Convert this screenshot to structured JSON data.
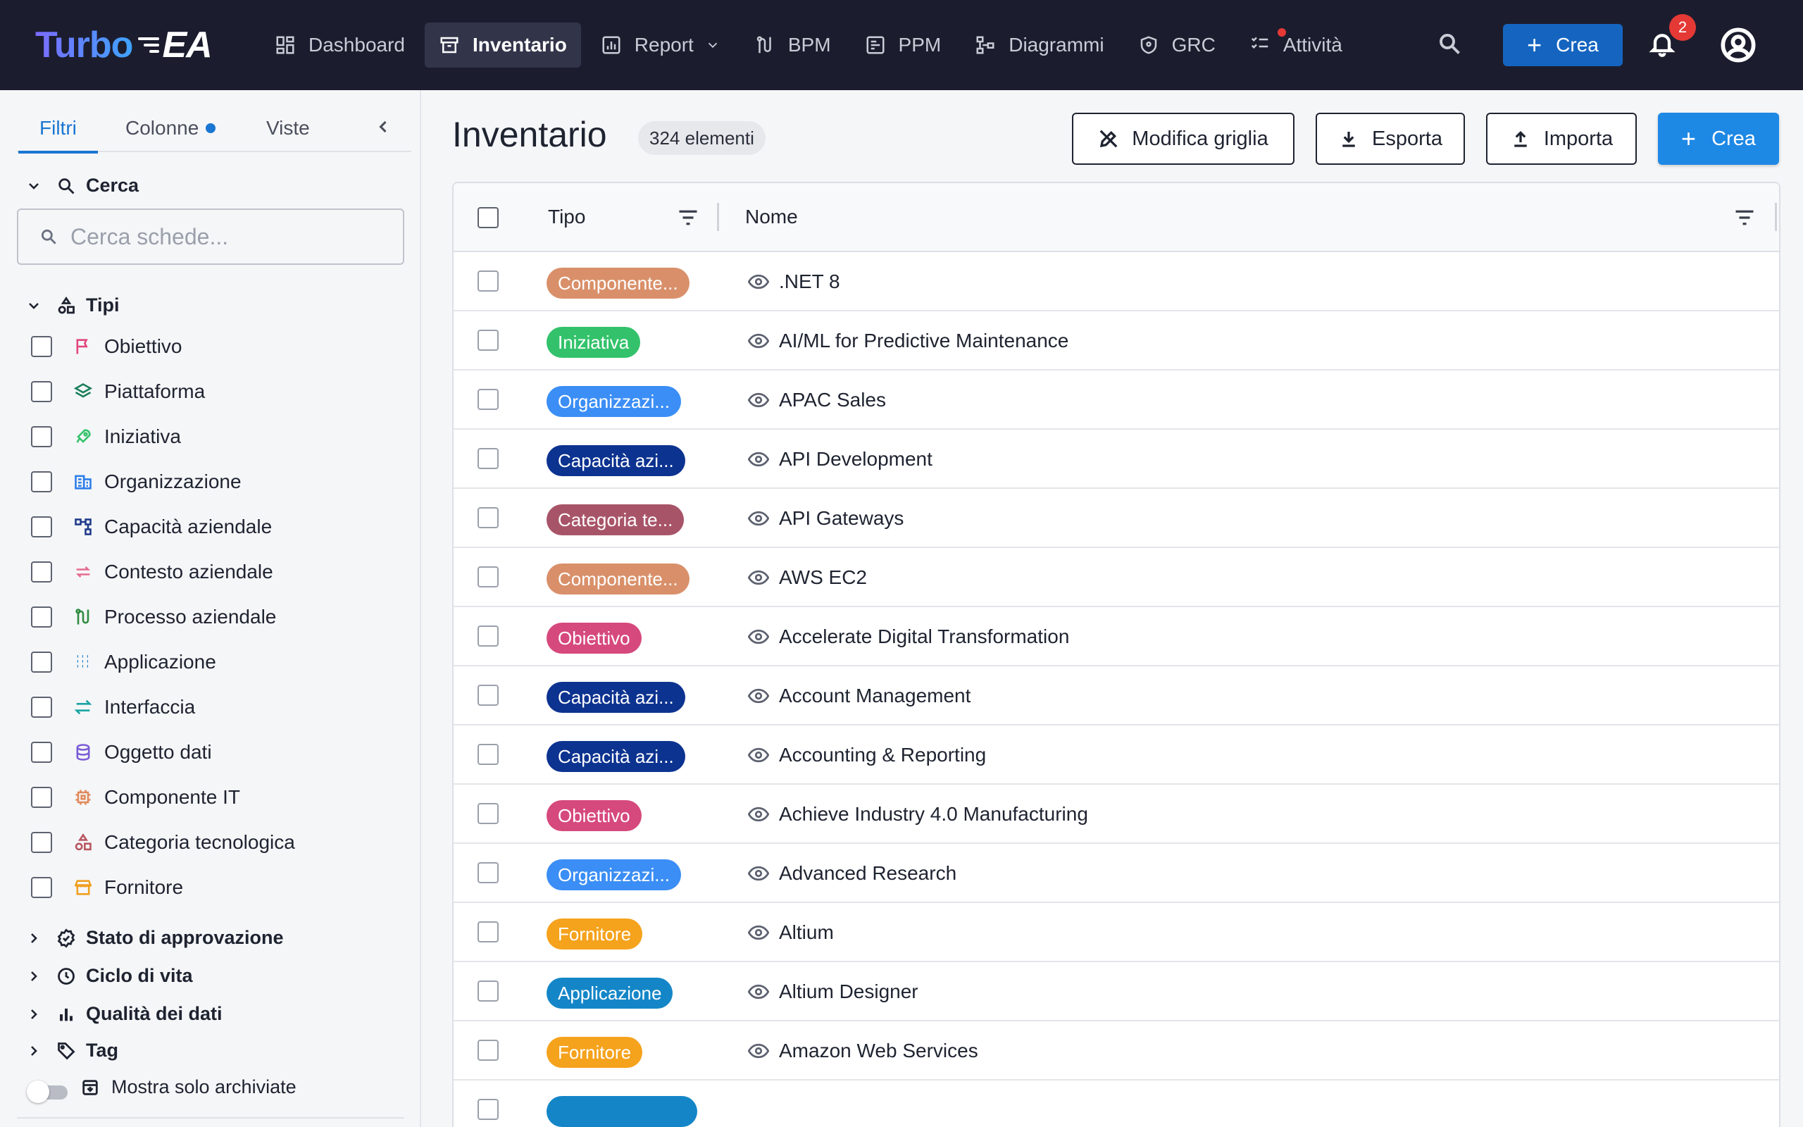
{
  "app": {
    "logo_text_a": "Turbo",
    "logo_text_b": "EA"
  },
  "nav": {
    "items": [
      {
        "label": "Dashboard",
        "icon": "dashboard-icon"
      },
      {
        "label": "Inventario",
        "icon": "inventory-icon",
        "active": true
      },
      {
        "label": "Report",
        "icon": "report-icon",
        "dropdown": true
      },
      {
        "label": "BPM",
        "icon": "bpm-icon"
      },
      {
        "label": "PPM",
        "icon": "ppm-icon"
      },
      {
        "label": "Diagrammi",
        "icon": "diagram-icon"
      },
      {
        "label": "GRC",
        "icon": "shield-icon"
      },
      {
        "label": "Attività",
        "icon": "tasks-icon",
        "dot": true
      }
    ],
    "create_label": "Crea",
    "notification_count": "2"
  },
  "sidebar": {
    "tabs": [
      {
        "label": "Filtri",
        "active": true
      },
      {
        "label": "Colonne",
        "dot": true
      },
      {
        "label": "Viste"
      }
    ],
    "search_section": "Cerca",
    "search_placeholder": "Cerca schede...",
    "types_section": "Tipi",
    "types": [
      {
        "label": "Obiettivo",
        "color": "#e0457b",
        "icon": "flag-icon"
      },
      {
        "label": "Piattaforma",
        "color": "#1a7f5a",
        "icon": "layers-icon"
      },
      {
        "label": "Iniziativa",
        "color": "#33c26b",
        "icon": "rocket-icon"
      },
      {
        "label": "Organizzazione",
        "color": "#2b7de9",
        "icon": "organization-icon"
      },
      {
        "label": "Capacità aziendale",
        "color": "#1e3a8a",
        "icon": "hierarchy-icon"
      },
      {
        "label": "Contesto aziendale",
        "color": "#e66b8f",
        "icon": "swap-icon"
      },
      {
        "label": "Processo aziendale",
        "color": "#2e8b3e",
        "icon": "process-icon"
      },
      {
        "label": "Applicazione",
        "color": "#1f7fc4",
        "icon": "apps-grid-icon"
      },
      {
        "label": "Interfaccia",
        "color": "#1aa3a3",
        "icon": "arrows-icon"
      },
      {
        "label": "Oggetto dati",
        "color": "#7b5cd6",
        "icon": "database-icon"
      },
      {
        "label": "Componente IT",
        "color": "#e08a5c",
        "icon": "chip-icon"
      },
      {
        "label": "Categoria tecnologica",
        "color": "#b85560",
        "icon": "category-icon"
      },
      {
        "label": "Fornitore",
        "color": "#f0a020",
        "icon": "store-icon"
      }
    ],
    "sections": [
      {
        "label": "Stato di approvazione",
        "icon": "approval-icon"
      },
      {
        "label": "Ciclo di vita",
        "icon": "clock-icon"
      },
      {
        "label": "Qualità dei dati",
        "icon": "bar-chart-icon"
      },
      {
        "label": "Tag",
        "icon": "tag-icon"
      }
    ],
    "archived_toggle": "Mostra solo archiviate"
  },
  "main": {
    "title": "Inventario",
    "count": "324 elementi",
    "buttons": {
      "edit_grid": "Modifica griglia",
      "export": "Esporta",
      "import": "Importa",
      "create": "Crea"
    },
    "columns": {
      "type": "Tipo",
      "name": "Nome"
    },
    "rows": [
      {
        "type": "Componente...",
        "color": "#d9906a",
        "name": ".NET 8"
      },
      {
        "type": "Iniziativa",
        "color": "#33c26b",
        "name": "AI/ML for Predictive Maintenance"
      },
      {
        "type": "Organizzazi...",
        "color": "#3b8ef5",
        "name": "APAC Sales"
      },
      {
        "type": "Capacità azi...",
        "color": "#0d3390",
        "name": "API Development"
      },
      {
        "type": "Categoria te...",
        "color": "#a85468",
        "name": "API Gateways"
      },
      {
        "type": "Componente...",
        "color": "#d9906a",
        "name": "AWS EC2"
      },
      {
        "type": "Obiettivo",
        "color": "#d6497c",
        "name": "Accelerate Digital Transformation"
      },
      {
        "type": "Capacità azi...",
        "color": "#0d3390",
        "name": "Account Management"
      },
      {
        "type": "Capacità azi...",
        "color": "#0d3390",
        "name": "Accounting & Reporting"
      },
      {
        "type": "Obiettivo",
        "color": "#d6497c",
        "name": "Achieve Industry 4.0 Manufacturing"
      },
      {
        "type": "Organizzazi...",
        "color": "#3b8ef5",
        "name": "Advanced Research"
      },
      {
        "type": "Fornitore",
        "color": "#f5a21c",
        "name": "Altium"
      },
      {
        "type": "Applicazione",
        "color": "#1486c7",
        "name": "Altium Designer"
      },
      {
        "type": "Fornitore",
        "color": "#f5a21c",
        "name": "Amazon Web Services"
      }
    ]
  }
}
